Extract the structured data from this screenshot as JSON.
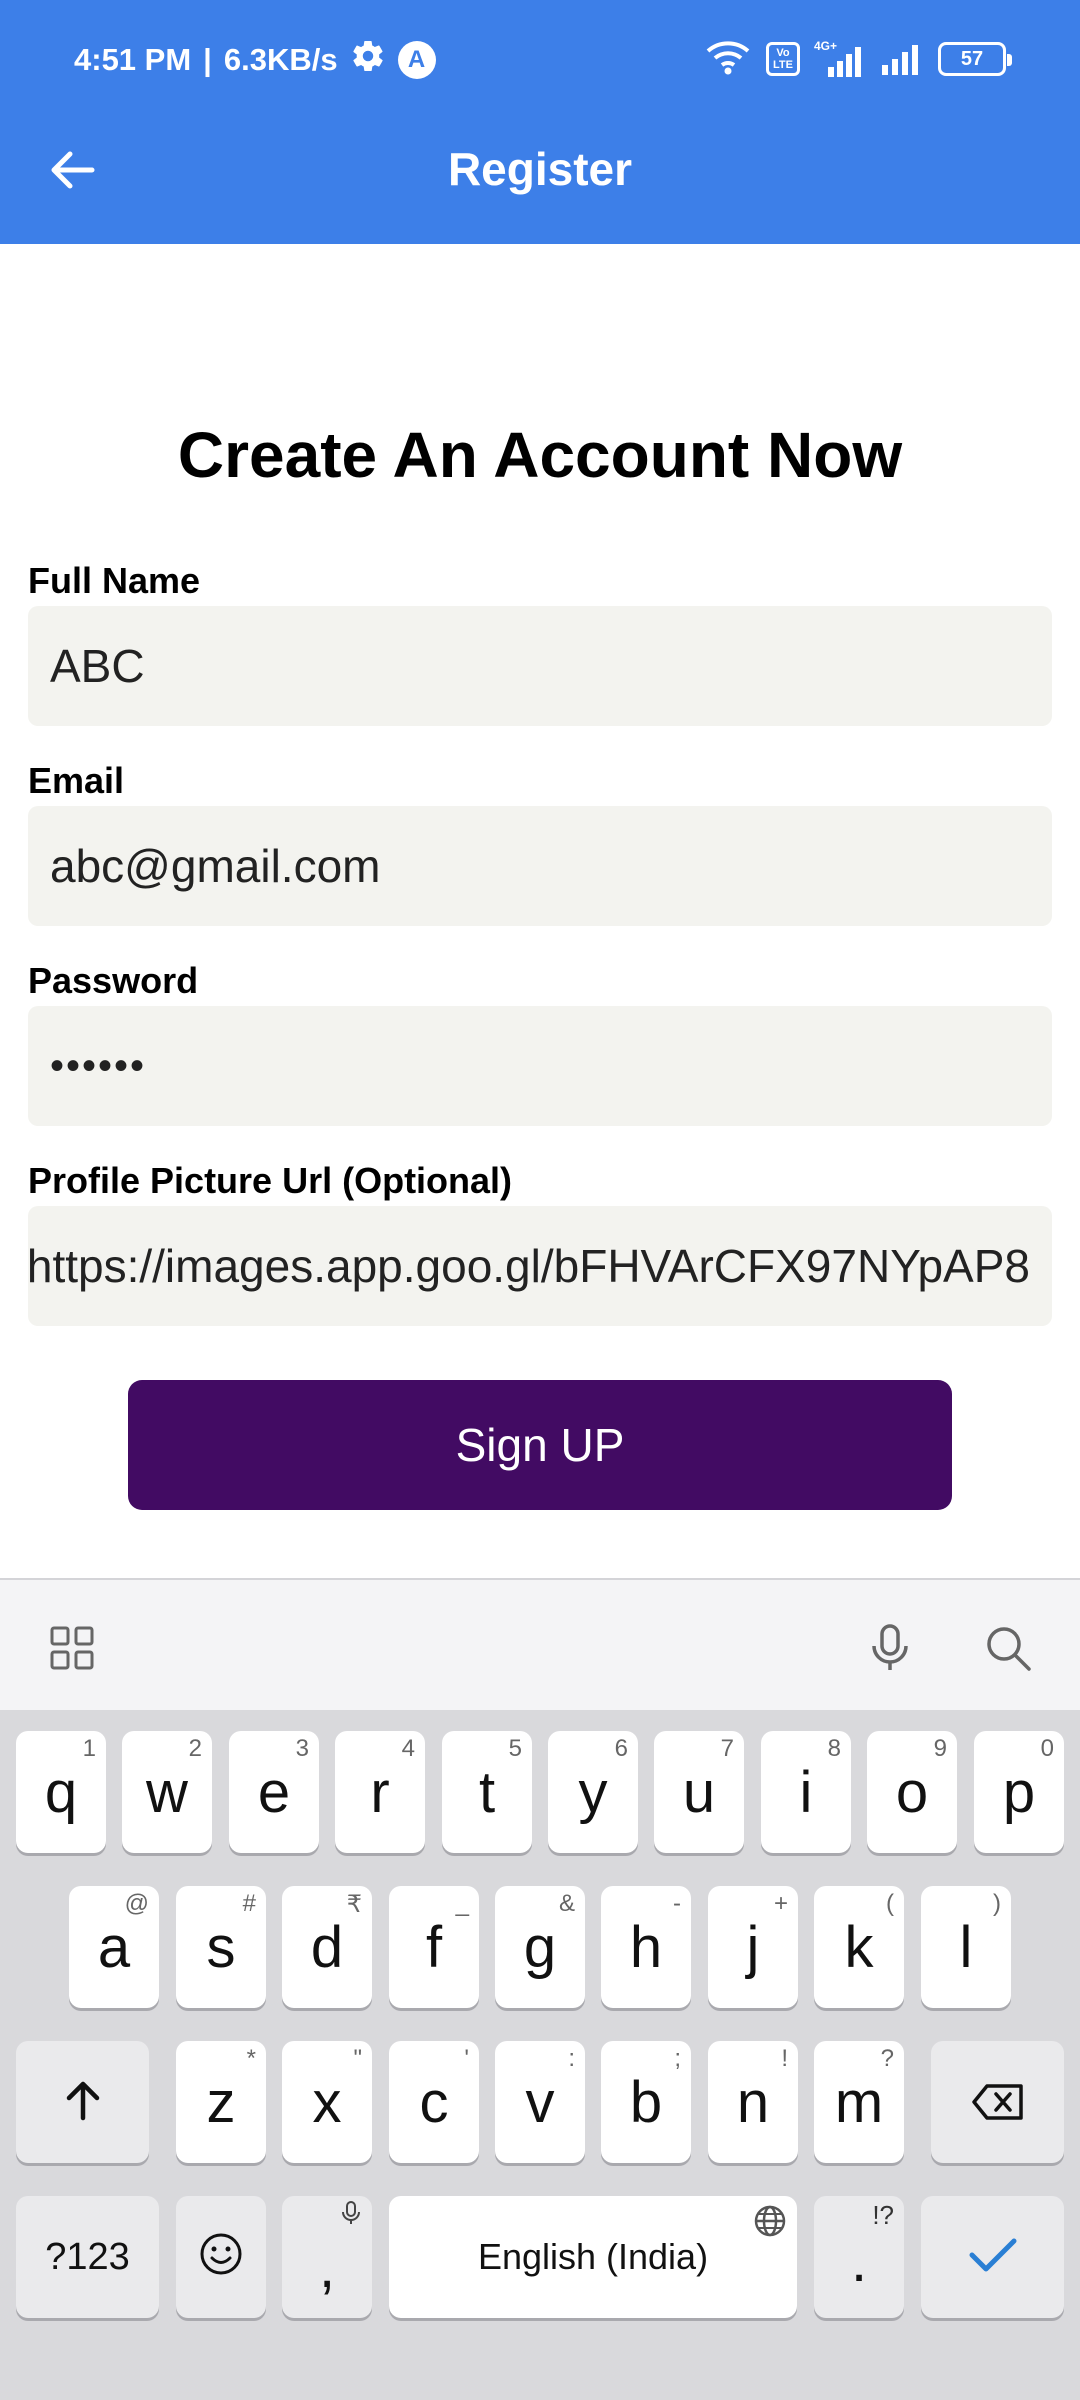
{
  "status_bar": {
    "time": "4:51 PM",
    "separator": "|",
    "speed": "6.3KB/s",
    "a_badge": "A",
    "volte": [
      "Vo",
      "LTE"
    ],
    "network": "4G+",
    "battery": "57"
  },
  "app_bar": {
    "title": "Register",
    "back_icon": "arrow-left-icon"
  },
  "form": {
    "heading": "Create An Account Now",
    "full_name": {
      "label": "Full Name",
      "value": "ABC"
    },
    "email": {
      "label": "Email",
      "value": "abc@gmail.com"
    },
    "password": {
      "label": "Password",
      "value": "••••••"
    },
    "profile_url": {
      "label": "Profile Picture Url (Optional)",
      "value": "https://images.app.goo.gl/bFHVArCFX97NYpAP8"
    },
    "submit_label": "Sign UP"
  },
  "keyboard": {
    "toolbar_icons": [
      "grid-icon",
      "microphone-icon",
      "search-icon"
    ],
    "row1": [
      {
        "key": "q",
        "hint": "1"
      },
      {
        "key": "w",
        "hint": "2"
      },
      {
        "key": "e",
        "hint": "3"
      },
      {
        "key": "r",
        "hint": "4"
      },
      {
        "key": "t",
        "hint": "5"
      },
      {
        "key": "y",
        "hint": "6"
      },
      {
        "key": "u",
        "hint": "7"
      },
      {
        "key": "i",
        "hint": "8"
      },
      {
        "key": "o",
        "hint": "9"
      },
      {
        "key": "p",
        "hint": "0"
      }
    ],
    "row2": [
      {
        "key": "a",
        "hint": "@"
      },
      {
        "key": "s",
        "hint": "#"
      },
      {
        "key": "d",
        "hint": "₹"
      },
      {
        "key": "f",
        "hint": "_"
      },
      {
        "key": "g",
        "hint": "&"
      },
      {
        "key": "h",
        "hint": "-"
      },
      {
        "key": "j",
        "hint": "+"
      },
      {
        "key": "k",
        "hint": "("
      },
      {
        "key": "l",
        "hint": ")"
      }
    ],
    "row3": [
      {
        "key": "z",
        "hint": "*"
      },
      {
        "key": "x",
        "hint": "\""
      },
      {
        "key": "c",
        "hint": "'"
      },
      {
        "key": "v",
        "hint": ":"
      },
      {
        "key": "b",
        "hint": ";"
      },
      {
        "key": "n",
        "hint": "!"
      },
      {
        "key": "m",
        "hint": "?"
      }
    ],
    "symbols_label": "?123",
    "comma": ",",
    "space_label": "English (India)",
    "period": ".",
    "period_hint": "!?",
    "accent_color": "#2a7fd4"
  }
}
